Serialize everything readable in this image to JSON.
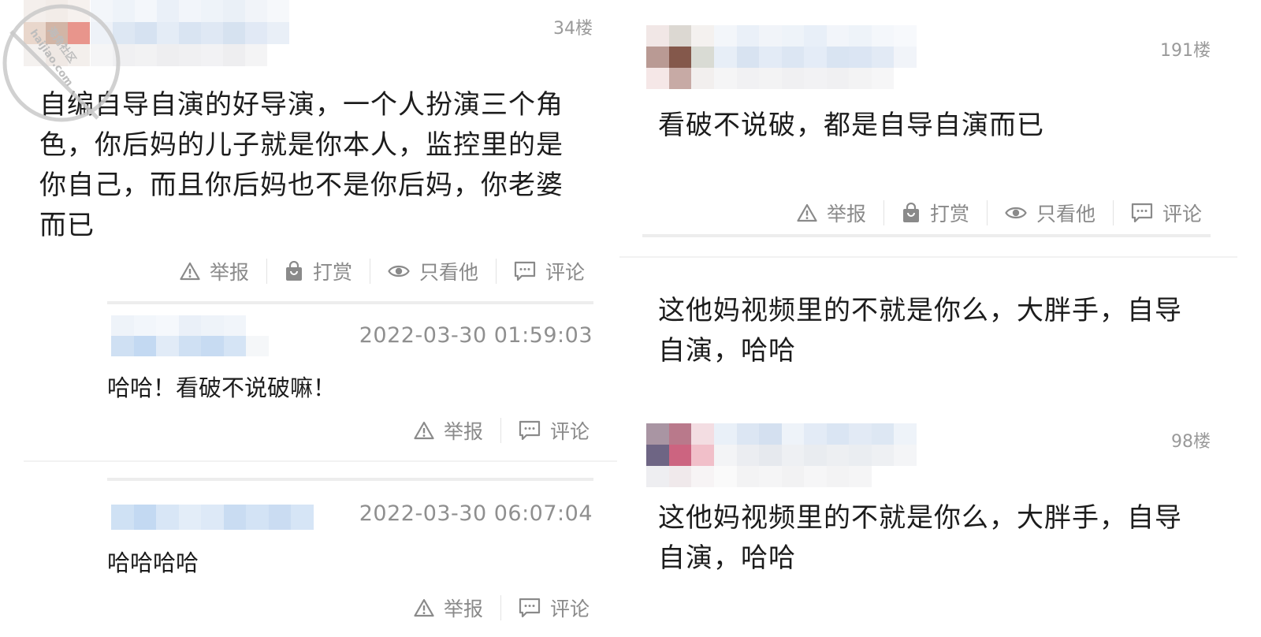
{
  "left": {
    "post": {
      "floor": "34楼",
      "text": "自编自导自演的好导演，一个人扮演三个角色，你后妈的儿子就是你本人，监控里的是你自己，而且你后妈也不是你后妈，你老婆而已",
      "lines": [
        "自编自导自演的好导演，一个人扮演三个角",
        "色，你后妈的儿子就是你本人，监控里的是",
        "你自己，而且你后妈也不是你后妈，你老婆",
        "而已"
      ],
      "actions": {
        "report": "举报",
        "reward": "打赏",
        "only_view": "只看他",
        "comment": "评论"
      }
    },
    "replies": [
      {
        "timestamp": "2022-03-30 01:59:03",
        "text": "哈哈！看破不说破嘛！",
        "actions": {
          "report": "举报",
          "comment": "评论"
        }
      },
      {
        "timestamp": "2022-03-30 06:07:04",
        "text": "哈哈哈哈",
        "actions": {
          "report": "举报",
          "comment": "评论"
        }
      }
    ]
  },
  "right": {
    "post1": {
      "floor": "191楼",
      "text": "看破不说破，都是自导自演而已",
      "actions": {
        "report": "举报",
        "reward": "打赏",
        "only_view": "只看他",
        "comment": "评论"
      }
    },
    "quote": {
      "text": "这他妈视频里的不就是你么，大胖手，自导自演，哈哈",
      "lines": [
        "这他妈视频里的不就是你么，大胖手，自导",
        "自演，哈哈"
      ]
    },
    "post2": {
      "floor": "98楼",
      "text": "这他妈视频里的不就是你么，大胖手，自导自演，哈哈",
      "lines": [
        "这他妈视频里的不就是你么，大胖手，自导",
        "自演，哈哈"
      ]
    }
  },
  "watermark": {
    "text": "海角社区",
    "domain": "haijiao.com"
  },
  "colors": {
    "text": "#1c1c1c",
    "muted": "#8a8a8a",
    "divider": "#ededed"
  }
}
